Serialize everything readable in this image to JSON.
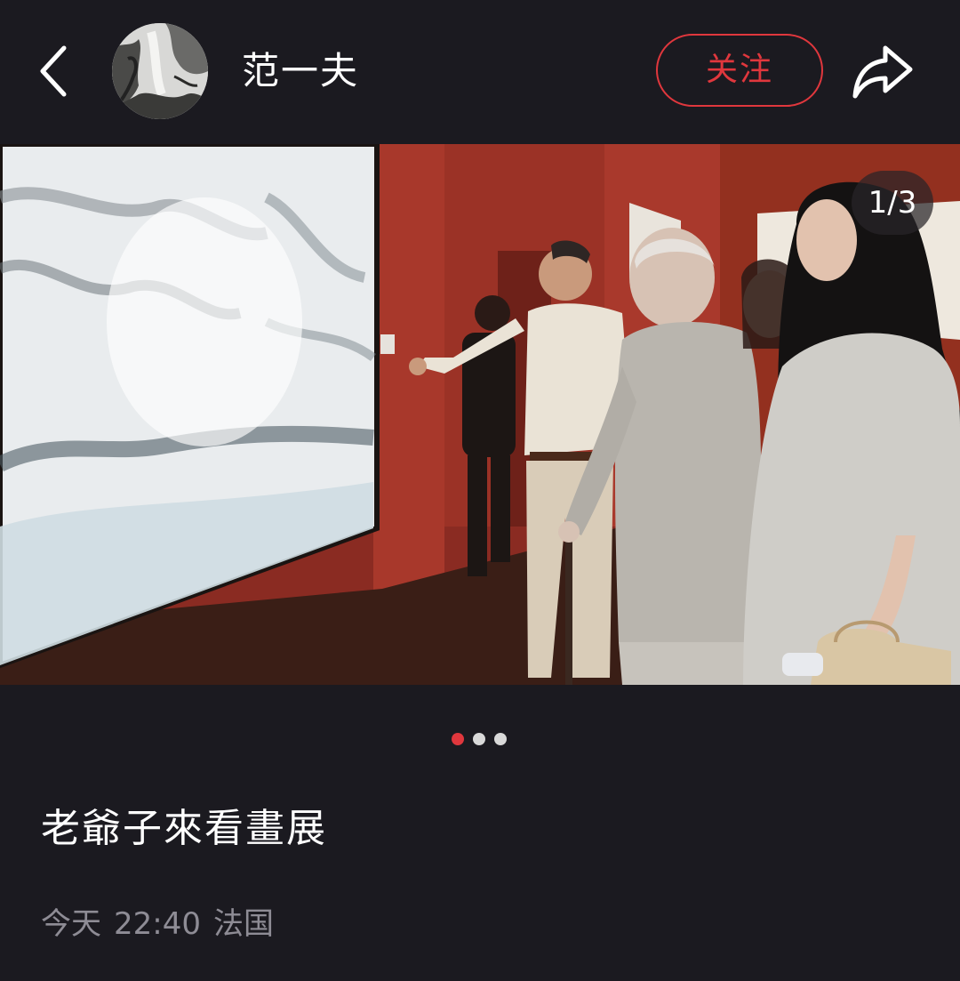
{
  "header": {
    "username": "范一夫",
    "follow_label": "关注",
    "back_icon": "chevron-left-icon",
    "share_icon": "share-arrow-icon"
  },
  "post": {
    "image_counter": "1/3",
    "current_index": 1,
    "total_images": 3,
    "caption": "老爺子來看畫展",
    "date": "今天",
    "time": "22:40",
    "location": "法国"
  },
  "colors": {
    "background": "#1b1a20",
    "accent": "#e0373d",
    "meta_text": "#8e8c95",
    "dot_inactive": "#d9d9d9"
  }
}
